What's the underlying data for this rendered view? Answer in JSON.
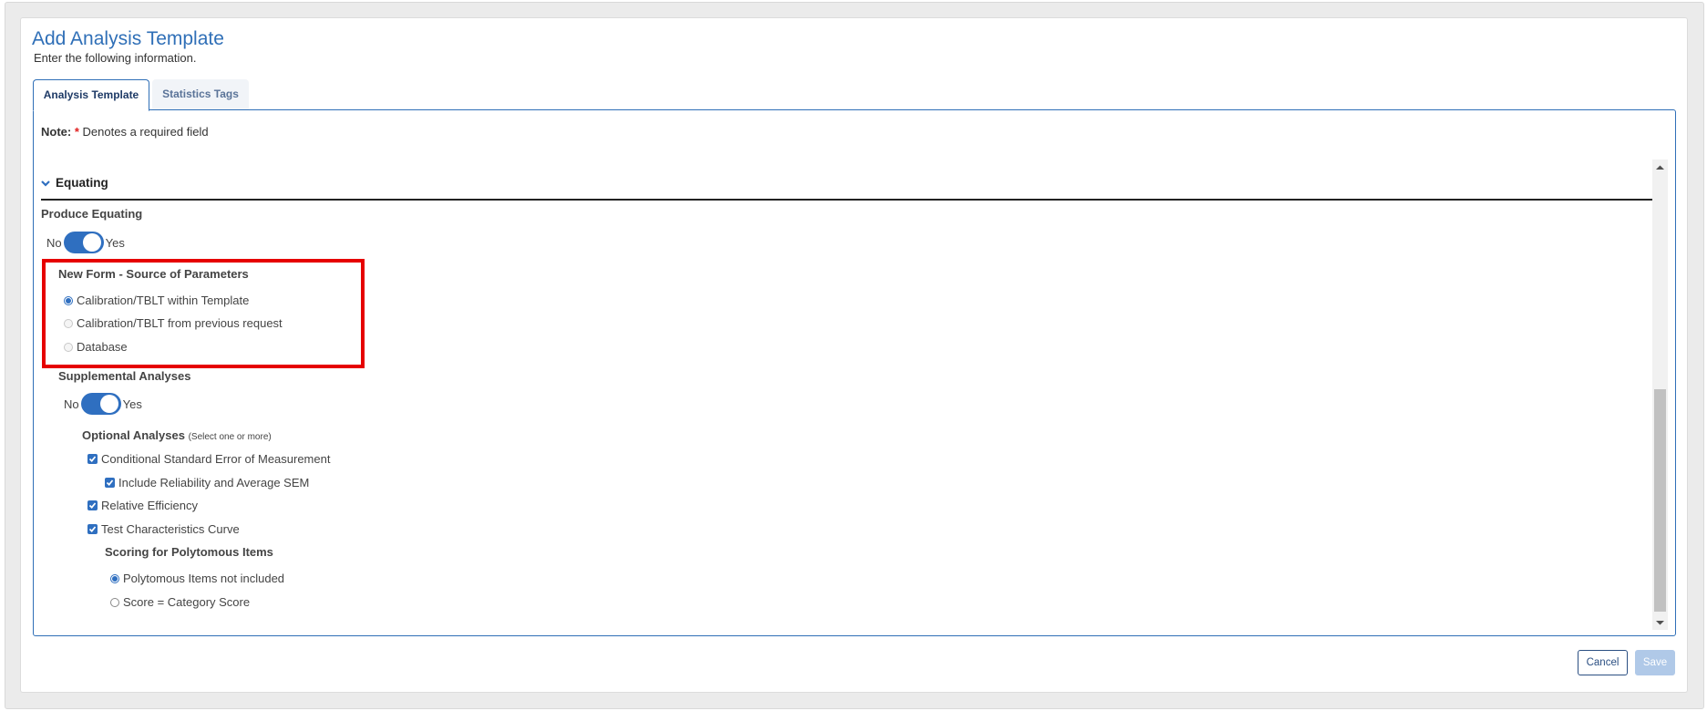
{
  "header": {
    "title": "Add Analysis Template",
    "subtitle": "Enter the following information."
  },
  "tabs": [
    {
      "label": "Analysis Template",
      "active": true
    },
    {
      "label": "Statistics Tags",
      "active": false
    }
  ],
  "note": {
    "prefix": "Note:",
    "asterisk": "*",
    "text": "Denotes a required field"
  },
  "section": {
    "title": "Equating",
    "expanded": true,
    "icon": "chevron-down-icon"
  },
  "produce_equating": {
    "label": "Produce Equating",
    "off_label": "No",
    "on_label": "Yes",
    "value": "Yes"
  },
  "new_form_source": {
    "label": "New Form - Source of Parameters",
    "highlighted": true,
    "highlight_color": "#e60000",
    "options": [
      {
        "label": "Calibration/TBLT within Template",
        "checked": true,
        "disabled": false
      },
      {
        "label": "Calibration/TBLT from previous request",
        "checked": false,
        "disabled": true
      },
      {
        "label": "Database",
        "checked": false,
        "disabled": true
      }
    ]
  },
  "supplemental": {
    "label": "Supplemental Analyses",
    "off_label": "No",
    "on_label": "Yes",
    "value": "Yes"
  },
  "optional_analyses": {
    "label": "Optional Analyses",
    "hint": "(Select one or more)",
    "items": [
      {
        "label": "Conditional Standard Error of Measurement",
        "checked": true
      },
      {
        "label": "Include Reliability and Average SEM",
        "checked": true
      },
      {
        "label": "Relative Efficiency",
        "checked": true
      },
      {
        "label": "Test Characteristics Curve",
        "checked": true
      }
    ]
  },
  "scoring": {
    "label": "Scoring for Polytomous Items",
    "options": [
      {
        "label": "Polytomous Items not included",
        "checked": true
      },
      {
        "label": "Score = Category Score",
        "checked": false
      }
    ]
  },
  "footer": {
    "cancel_label": "Cancel",
    "save_label": "Save",
    "save_enabled": false
  },
  "colors": {
    "accent": "#2f6fc0",
    "title": "#2f6fb7",
    "required": "#e02020"
  }
}
